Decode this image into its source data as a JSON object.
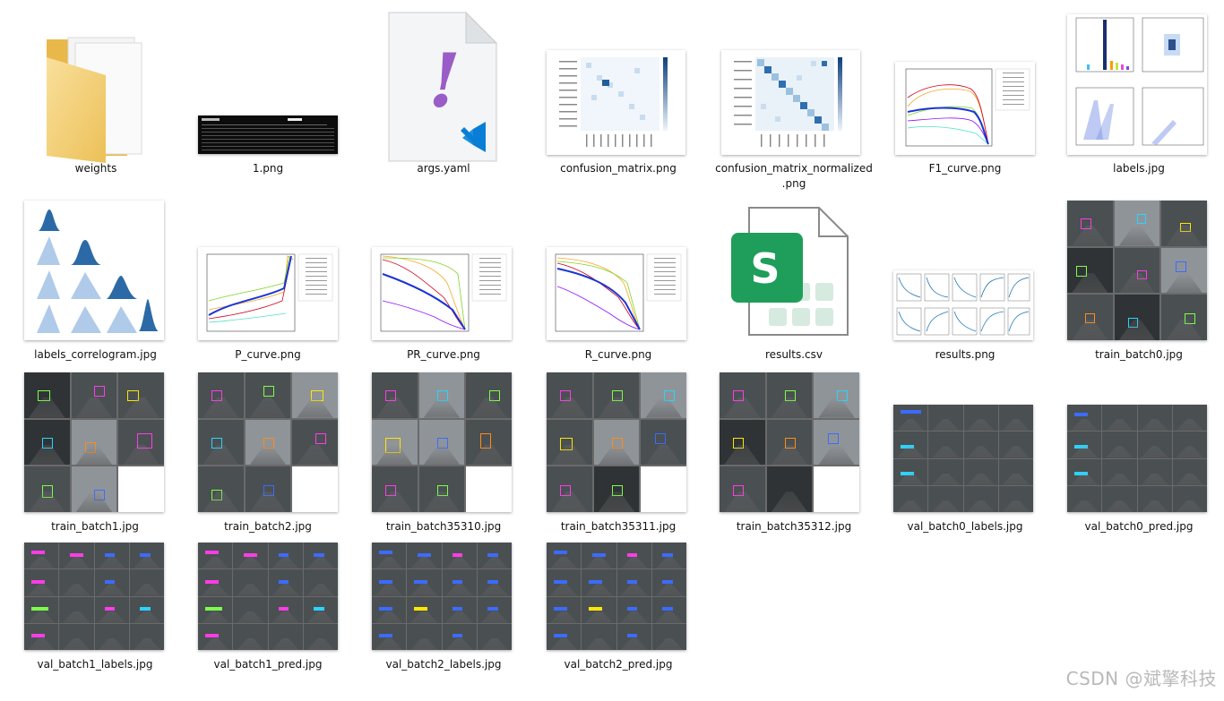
{
  "files": [
    {
      "id": "weights",
      "name": "weights",
      "type": "folder-icon"
    },
    {
      "id": "1-png",
      "name": "1.png",
      "type": "terminal-screenshot"
    },
    {
      "id": "args-yaml",
      "name": "args.yaml",
      "type": "vscode-yaml-file-icon"
    },
    {
      "id": "confusion-matrix",
      "name": "confusion_matrix.png",
      "type": "confusion-matrix-thumbnail"
    },
    {
      "id": "confusion-matrix-normalized",
      "name": "confusion_matrix_normalized\n.png",
      "type": "confusion-matrix-thumbnail"
    },
    {
      "id": "f1-curve",
      "name": "F1_curve.png",
      "type": "curve-thumbnail"
    },
    {
      "id": "labels",
      "name": "labels.jpg",
      "type": "labels-thumbnail"
    },
    {
      "id": "labels-correlogram",
      "name": "labels_correlogram.jpg",
      "type": "correlogram-thumbnail"
    },
    {
      "id": "p-curve",
      "name": "P_curve.png",
      "type": "curve-thumbnail"
    },
    {
      "id": "pr-curve",
      "name": "PR_curve.png",
      "type": "curve-thumbnail"
    },
    {
      "id": "r-curve",
      "name": "R_curve.png",
      "type": "curve-thumbnail"
    },
    {
      "id": "results-csv",
      "name": "results.csv",
      "type": "spreadsheet-file-icon"
    },
    {
      "id": "results-png",
      "name": "results.png",
      "type": "results-thumbnail"
    },
    {
      "id": "train-batch0",
      "name": "train_batch0.jpg",
      "type": "mosaic-thumbnail"
    },
    {
      "id": "train-batch1",
      "name": "train_batch1.jpg",
      "type": "mosaic-thumbnail"
    },
    {
      "id": "train-batch2",
      "name": "train_batch2.jpg",
      "type": "mosaic-thumbnail"
    },
    {
      "id": "train-batch35310",
      "name": "train_batch35310.jpg",
      "type": "mosaic-thumbnail"
    },
    {
      "id": "train-batch35311",
      "name": "train_batch35311.jpg",
      "type": "mosaic-thumbnail"
    },
    {
      "id": "train-batch35312",
      "name": "train_batch35312.jpg",
      "type": "mosaic-thumbnail"
    },
    {
      "id": "val-batch0-labels",
      "name": "val_batch0_labels.jpg",
      "type": "mosaic-thumbnail"
    },
    {
      "id": "val-batch0-pred",
      "name": "val_batch0_pred.jpg",
      "type": "mosaic-thumbnail"
    },
    {
      "id": "val-batch1-labels",
      "name": "val_batch1_labels.jpg",
      "type": "mosaic-thumbnail"
    },
    {
      "id": "val-batch1-pred",
      "name": "val_batch1_pred.jpg",
      "type": "mosaic-thumbnail"
    },
    {
      "id": "val-batch2-labels",
      "name": "val_batch2_labels.jpg",
      "type": "mosaic-thumbnail"
    },
    {
      "id": "val-batch2-pred",
      "name": "val_batch2_pred.jpg",
      "type": "mosaic-thumbnail"
    }
  ],
  "watermark": "CSDN @斌擎科技",
  "icon_glyphs": {
    "yaml": "!",
    "csv": "S"
  },
  "colors": {
    "folder": "#f6cf67",
    "vscode_blue": "#0a7ed6",
    "yaml_purple": "#9a5cc6",
    "sheets_green": "#1e9e5a",
    "heatmap_blue": "#1f5f9e"
  }
}
